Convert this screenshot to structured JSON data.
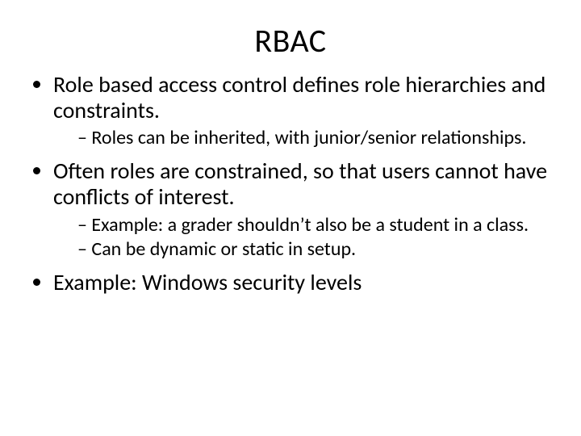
{
  "title": "RBAC",
  "bullets": [
    {
      "text": "Role based access control defines role hierarchies and constraints.",
      "sub": [
        "Roles can be inherited, with junior/senior relationships."
      ]
    },
    {
      "text": "Often roles are constrained, so that users cannot have conflicts of interest.",
      "sub": [
        "Example: a grader shouldn’t also be a student in a class.",
        "Can be dynamic or static in setup."
      ]
    },
    {
      "text": "Example: Windows security levels",
      "sub": []
    }
  ]
}
